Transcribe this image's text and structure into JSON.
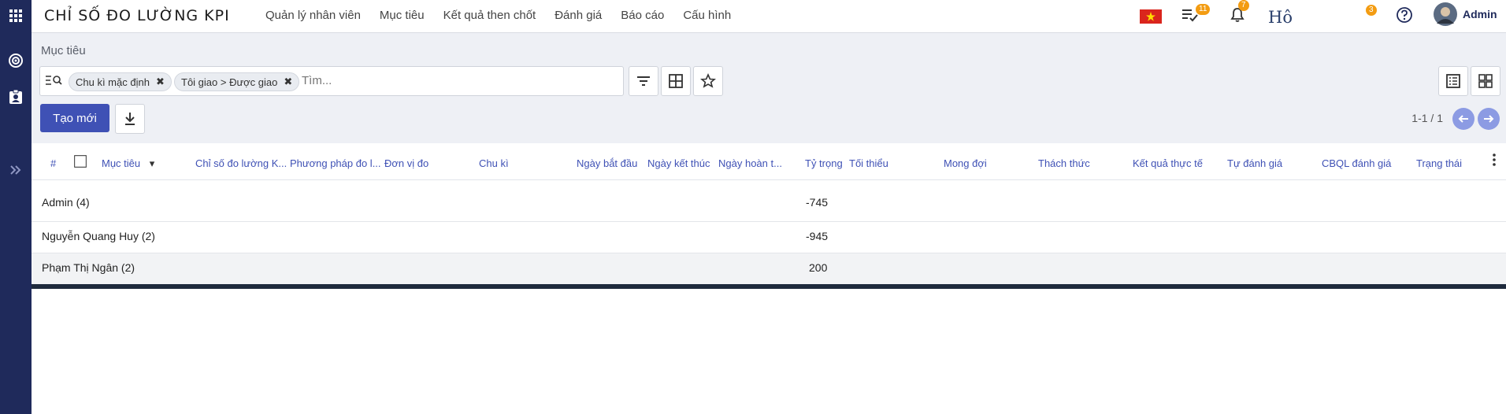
{
  "app_title": "CHỈ SỐ ĐO LƯỜNG KPI",
  "nav": [
    "Quản lý nhân viên",
    "Mục tiêu",
    "Kết quả then chốt",
    "Đánh giá",
    "Báo cáo",
    "Cấu hình"
  ],
  "topbar": {
    "tasks_badge": "11",
    "notifications_badge": "7",
    "ho_text": "Hô",
    "small_badge": "3",
    "user_name": "Admin"
  },
  "breadcrumb": "Mục tiêu",
  "search": {
    "facets": [
      {
        "label": "Chu kì mặc định"
      },
      {
        "label": "Tôi giao > Được giao"
      }
    ],
    "placeholder": "Tìm..."
  },
  "create_button": "Tạo mới",
  "pager": "1-1 / 1",
  "columns": [
    "#",
    "Mục tiêu",
    "Chỉ số đo lường K...",
    "Phương pháp đo l...",
    "Đơn vị đo",
    "Chu kì",
    "Ngày bắt đầu",
    "Ngày kết thúc",
    "Ngày hoàn t...",
    "Tỷ trọng",
    "Tối thiểu",
    "Mong đợi",
    "Thách thức",
    "Kết quả thực tế",
    "Tự đánh giá",
    "CBQL đánh giá",
    "Trạng thái"
  ],
  "groups": [
    {
      "name": "Admin (4)",
      "weight": "-745"
    },
    {
      "name": "Nguyễn Quang Huy (2)",
      "weight": "-945"
    },
    {
      "name": "Phạm Thị Ngân (2)",
      "weight": "200"
    }
  ],
  "colors": {
    "sidebar": "#1f2a5b",
    "primary": "#3f51b5",
    "badge": "#f39c12",
    "header_text": "#3f51b5"
  }
}
